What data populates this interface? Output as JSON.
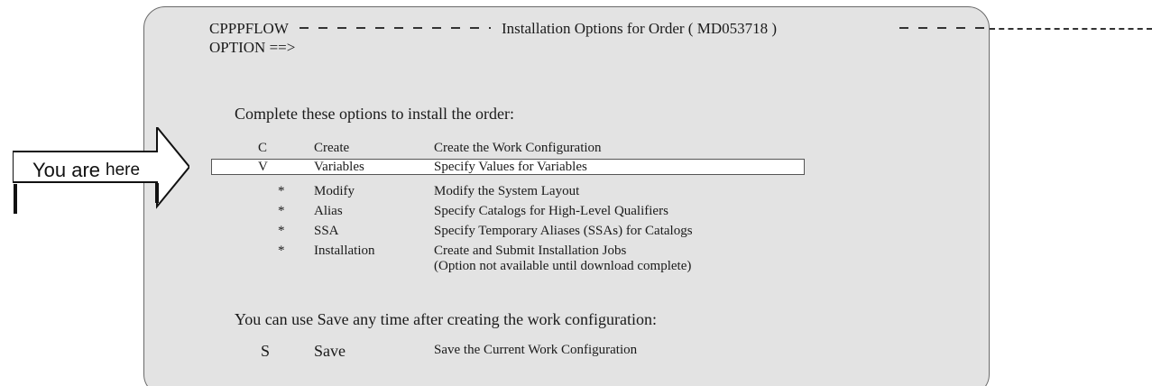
{
  "screen": {
    "panel_name": "CPPPFLOW",
    "title": "Installation Options for Order ( MD053718 )",
    "command_prompt": "OPTION ==>",
    "intro": "Complete these options to install the order:",
    "options": [
      {
        "code": "C",
        "name": "Create",
        "description": "Create the Work Configuration",
        "description2": ""
      },
      {
        "code": "V",
        "name": "Variables",
        "description": "Specify Values for Variables",
        "description2": ""
      },
      {
        "code": "*",
        "name": "Modify",
        "description": "Modify the System Layout",
        "description2": ""
      },
      {
        "code": "*",
        "name": "Alias",
        "description": "Specify Catalogs for High-Level Qualifiers",
        "description2": ""
      },
      {
        "code": "*",
        "name": "SSA",
        "description": "Specify Temporary Aliases (SSAs) for Catalogs",
        "description2": ""
      },
      {
        "code": "*",
        "name": "Installation",
        "description": "Create and Submit Installation Jobs",
        "description2": "(Option not available until download complete)"
      }
    ],
    "save_note": "You can use Save any time after creating the work configuration:",
    "save_option": {
      "code": "S",
      "name": "Save",
      "description": "Save the Current Work Configuration"
    }
  },
  "callout": {
    "text_main": "You are",
    "text_small": "here"
  },
  "colors": {
    "panel_bg": "#e3e3e3",
    "highlight_bg": "#ffffff",
    "text": "#1a1a1a"
  }
}
